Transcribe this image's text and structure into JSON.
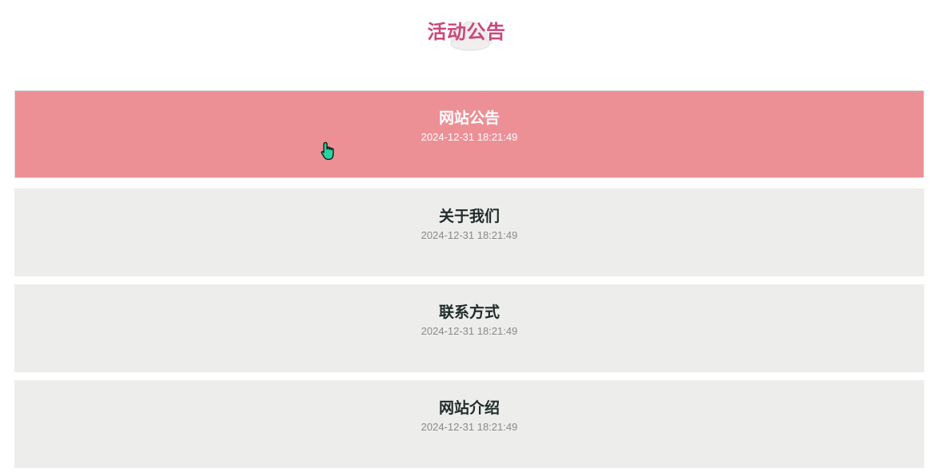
{
  "title": "活动公告",
  "colors": {
    "title": "#c9487c",
    "active_bg": "#ec9096",
    "active_text": "#ffffff",
    "inactive_bg": "#ededeb",
    "item_title": "#1f2b2b",
    "item_date": "#8a8a8a"
  },
  "notices": [
    {
      "title": "网站公告",
      "date": "2024-12-31 18:21:49",
      "active": true
    },
    {
      "title": "关于我们",
      "date": "2024-12-31 18:21:49",
      "active": false
    },
    {
      "title": "联系方式",
      "date": "2024-12-31 18:21:49",
      "active": false
    },
    {
      "title": "网站介绍",
      "date": "2024-12-31 18:21:49",
      "active": false
    }
  ],
  "cursor": {
    "type": "hand-pointer-icon"
  }
}
